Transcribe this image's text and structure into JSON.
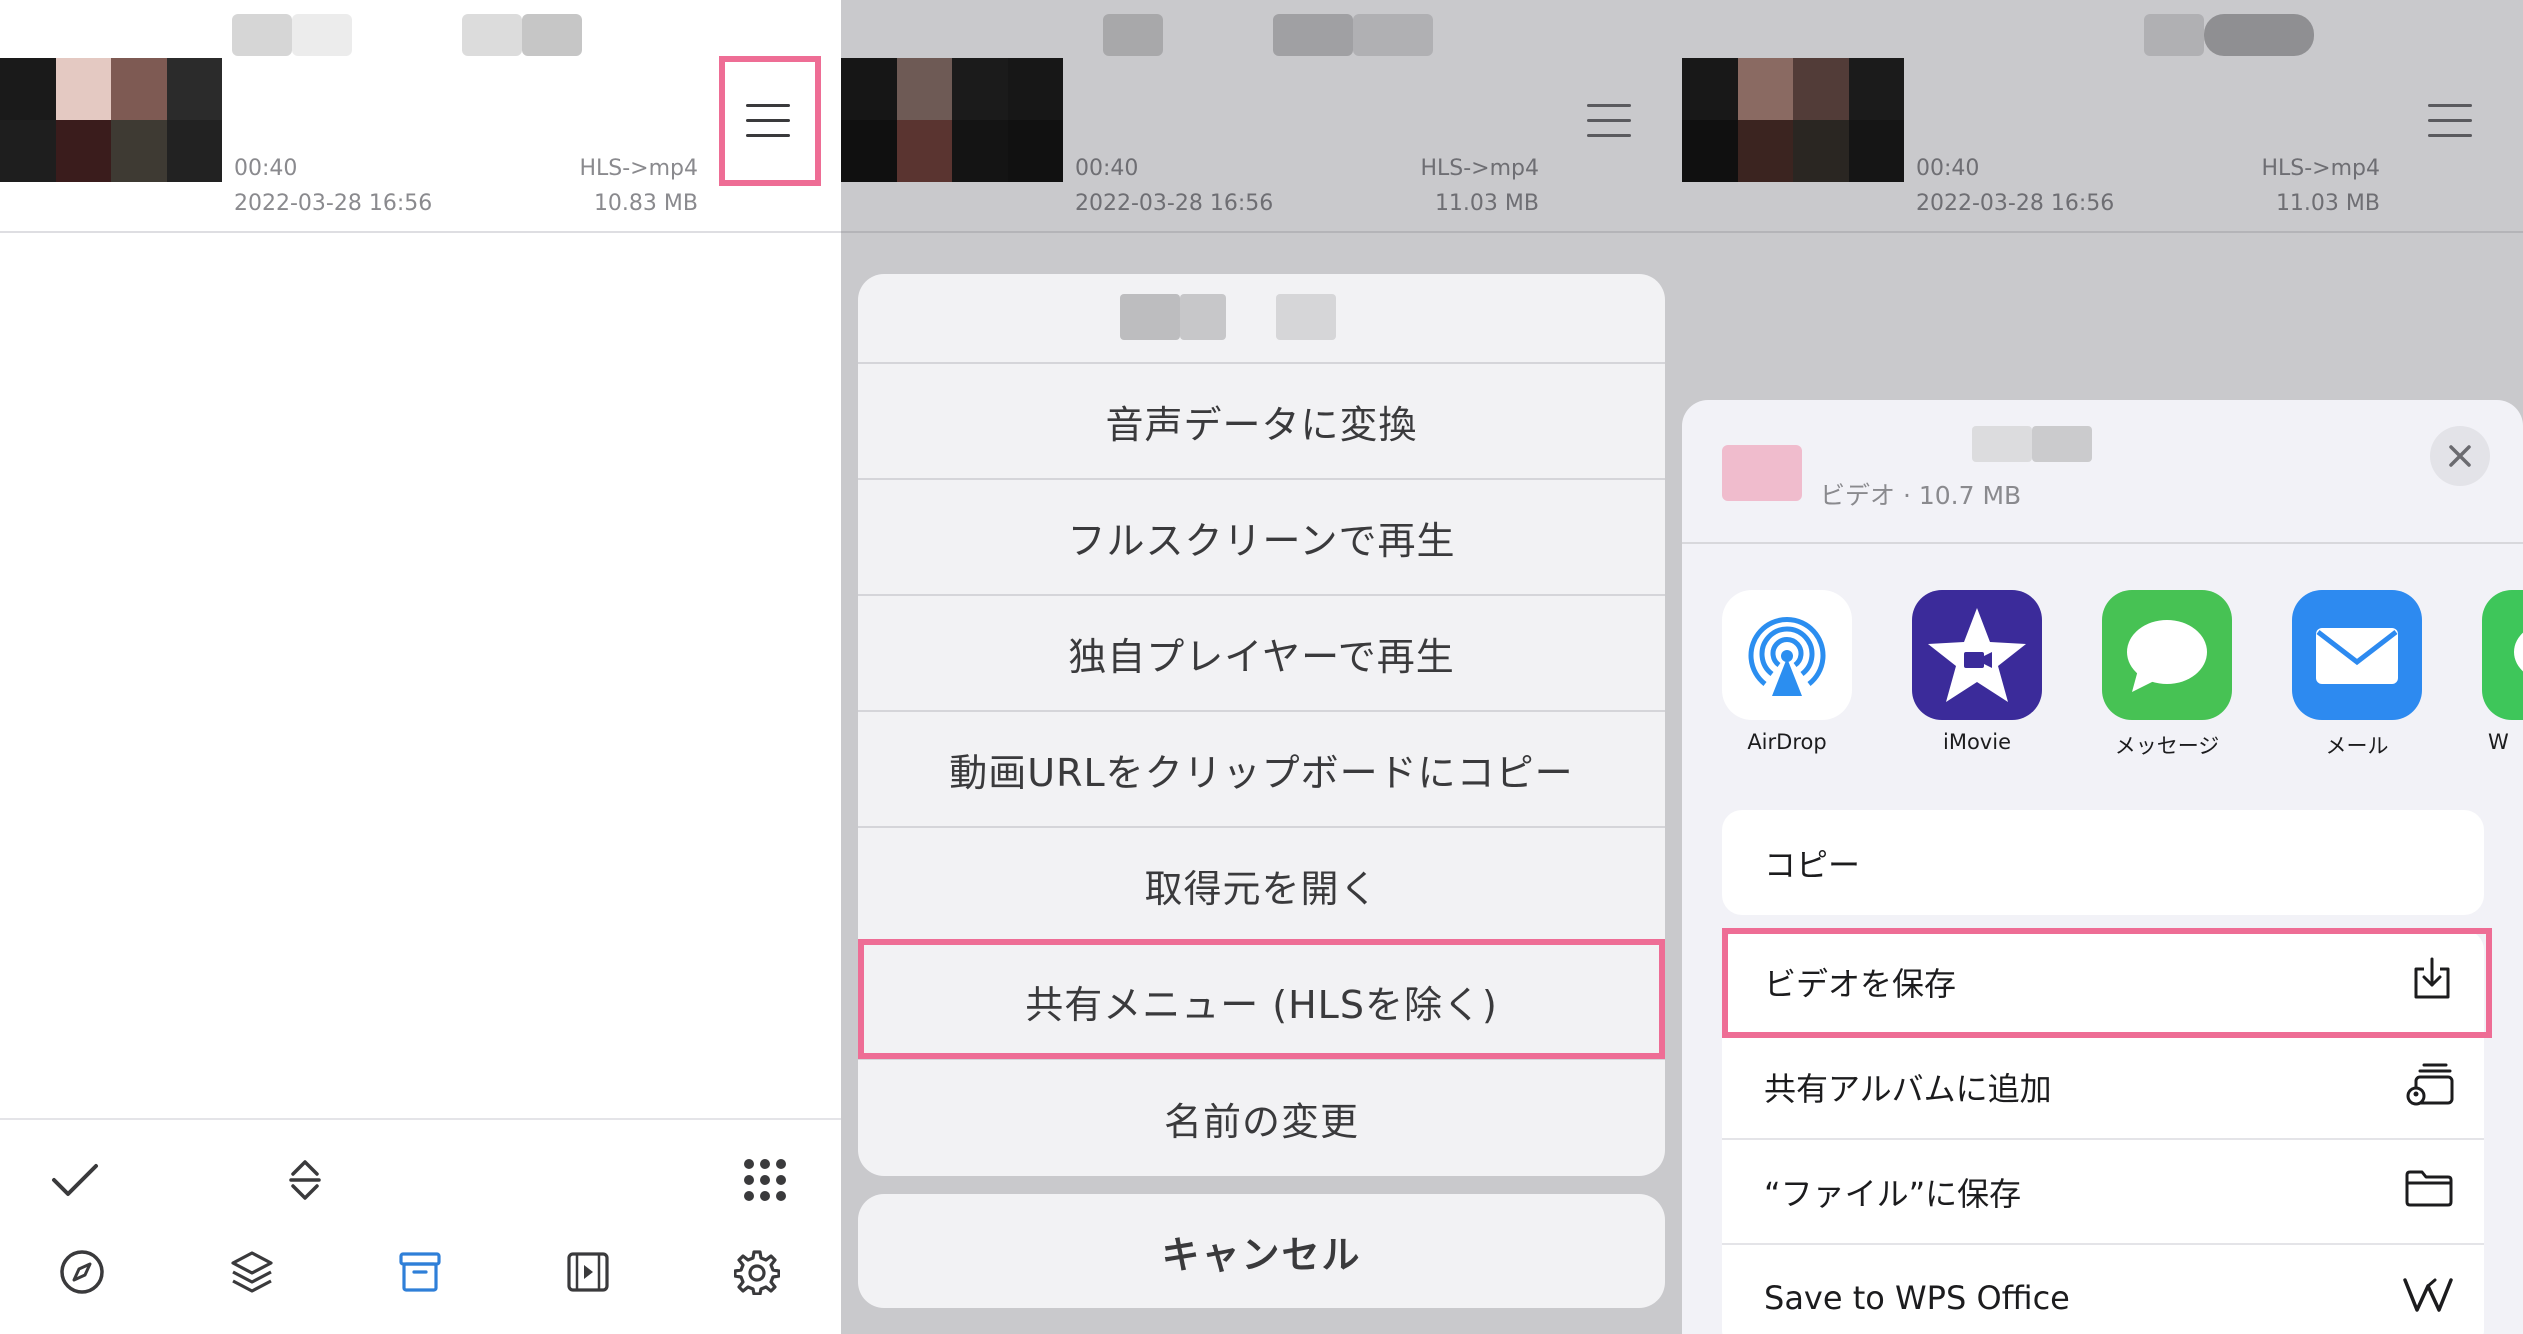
{
  "panel1": {
    "video": {
      "duration": "00:40",
      "format": "HLS->mp4",
      "date": "2022-03-28 16:56",
      "size": "10.83 MB"
    },
    "toolbar_top": [
      "checkmark-icon",
      "sort-icon",
      "grid-dots-icon"
    ],
    "toolbar_bottom": [
      "compass-icon",
      "layers-icon",
      "archive-icon",
      "video-player-icon",
      "gear-icon"
    ],
    "active_tab": "archive-icon",
    "accent": "#2f7fd8",
    "highlight": "#ee6d95"
  },
  "panel2": {
    "video": {
      "duration": "00:40",
      "format": "HLS->mp4",
      "date": "2022-03-28 16:56",
      "size": "11.03 MB"
    },
    "menu_items": [
      "音声データに変換",
      "フルスクリーンで再生",
      "独自プレイヤーで再生",
      "動画URLをクリップボードにコピー",
      "取得元を開く",
      "共有メニュー (HLSを除く)",
      "名前の変更"
    ],
    "cancel_label": "キャンセル",
    "highlighted_item": "共有メニュー (HLSを除く)"
  },
  "panel3": {
    "video": {
      "duration": "00:40",
      "format": "HLS->mp4",
      "date": "2022-03-28 16:56",
      "size": "11.03 MB"
    },
    "share_header": {
      "subtitle": "ビデオ · 10.7 MB"
    },
    "apps": [
      "AirDrop",
      "iMovie",
      "メッセージ",
      "メール",
      "W"
    ],
    "actions_group1": [
      "コピー"
    ],
    "actions_group2": [
      {
        "label": "ビデオを保存",
        "icon": "save-download-icon"
      },
      {
        "label": "共有アルバムに追加",
        "icon": "shared-album-icon"
      },
      {
        "label": "“ファイル”に保存",
        "icon": "folder-icon"
      },
      {
        "label": "Save to WPS Office",
        "icon": "wps-office-icon"
      }
    ],
    "highlighted_action": "ビデオを保存"
  }
}
